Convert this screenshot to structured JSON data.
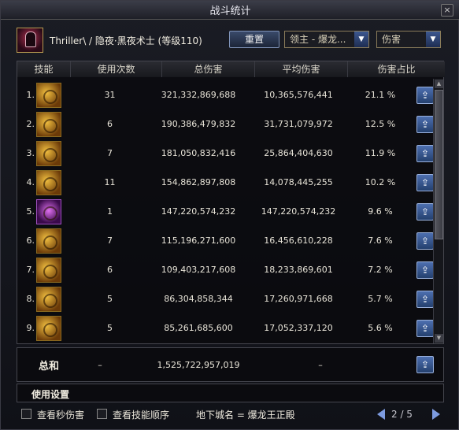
{
  "window": {
    "title": "战斗统计",
    "close": "×"
  },
  "header": {
    "character": "Thriller\\ / 隐夜·黑夜术士 (等级110)",
    "reset_label": "重置",
    "target_select": "领主 - 爆龙...",
    "metric_select": "伤害"
  },
  "columns": [
    "技能",
    "使用次数",
    "总伤害",
    "平均伤害",
    "伤害占比"
  ],
  "rows": [
    {
      "idx": "1.",
      "uses": "31",
      "total": "321,332,869,688",
      "avg": "10,365,576,441",
      "pct": "21.1 %",
      "icon": "skill-icon-gold"
    },
    {
      "idx": "2.",
      "uses": "6",
      "total": "190,386,479,832",
      "avg": "31,731,079,972",
      "pct": "12.5 %",
      "icon": "skill-icon-gold"
    },
    {
      "idx": "3.",
      "uses": "7",
      "total": "181,050,832,416",
      "avg": "25,864,404,630",
      "pct": "11.9 %",
      "icon": "skill-icon-gold"
    },
    {
      "idx": "4.",
      "uses": "11",
      "total": "154,862,897,808",
      "avg": "14,078,445,255",
      "pct": "10.2 %",
      "icon": "skill-icon-gold"
    },
    {
      "idx": "5.",
      "uses": "1",
      "total": "147,220,574,232",
      "avg": "147,220,574,232",
      "pct": "9.6 %",
      "icon": "skill-icon-purple"
    },
    {
      "idx": "6.",
      "uses": "7",
      "total": "115,196,271,600",
      "avg": "16,456,610,228",
      "pct": "7.6 %",
      "icon": "skill-icon-gold"
    },
    {
      "idx": "7.",
      "uses": "6",
      "total": "109,403,217,608",
      "avg": "18,233,869,601",
      "pct": "7.2 %",
      "icon": "skill-icon-gold"
    },
    {
      "idx": "8.",
      "uses": "5",
      "total": "86,304,858,344",
      "avg": "17,260,971,668",
      "pct": "5.7 %",
      "icon": "skill-icon-gold"
    },
    {
      "idx": "9.",
      "uses": "5",
      "total": "85,261,685,600",
      "avg": "17,052,337,120",
      "pct": "5.6 %",
      "icon": "skill-icon-gold"
    }
  ],
  "summary": {
    "label": "总和",
    "uses": "–",
    "total": "1,525,722,957,019",
    "avg": "–"
  },
  "settings_label": "使用设置",
  "footer": {
    "dps_label": "查看秒伤害",
    "order_label": "查看技能顺序",
    "dungeon": "地下城名 = 爆龙王正殿",
    "page": "2 / 5"
  }
}
